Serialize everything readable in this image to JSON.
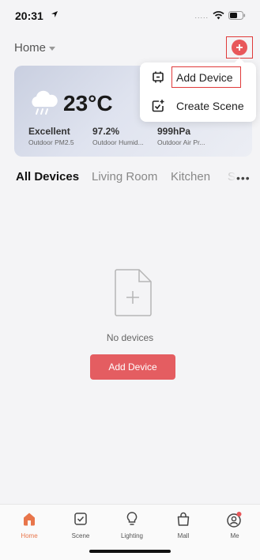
{
  "status_bar": {
    "time": "20:31",
    "signal": "....."
  },
  "header": {
    "home_label": "Home"
  },
  "weather": {
    "temperature": "23°C",
    "metrics": [
      {
        "value": "Excellent",
        "label": "Outdoor PM2.5"
      },
      {
        "value": "97.2%",
        "label": "Outdoor Humid..."
      },
      {
        "value": "999hPa",
        "label": "Outdoor Air Pr..."
      }
    ]
  },
  "popup_menu": {
    "items": [
      {
        "label": "Add Device",
        "icon": "add-device-icon"
      },
      {
        "label": "Create Scene",
        "icon": "create-scene-icon"
      }
    ]
  },
  "tabs": [
    {
      "label": "All Devices",
      "active": true
    },
    {
      "label": "Living Room",
      "active": false
    },
    {
      "label": "Kitchen",
      "active": false
    },
    {
      "label": "S",
      "active": false
    }
  ],
  "tabs_more": "•••",
  "empty_state": {
    "text": "No devices",
    "button_label": "Add Device"
  },
  "bottom_nav": [
    {
      "label": "Home",
      "icon": "home-icon",
      "active": true
    },
    {
      "label": "Scene",
      "icon": "scene-icon",
      "active": false
    },
    {
      "label": "Lighting",
      "icon": "lighting-icon",
      "active": false
    },
    {
      "label": "Mall",
      "icon": "mall-icon",
      "active": false
    },
    {
      "label": "Me",
      "icon": "me-icon",
      "active": false
    }
  ],
  "colors": {
    "accent": "#e45d61",
    "active_nav": "#e8754a",
    "highlight_box": "#e03a3a"
  }
}
